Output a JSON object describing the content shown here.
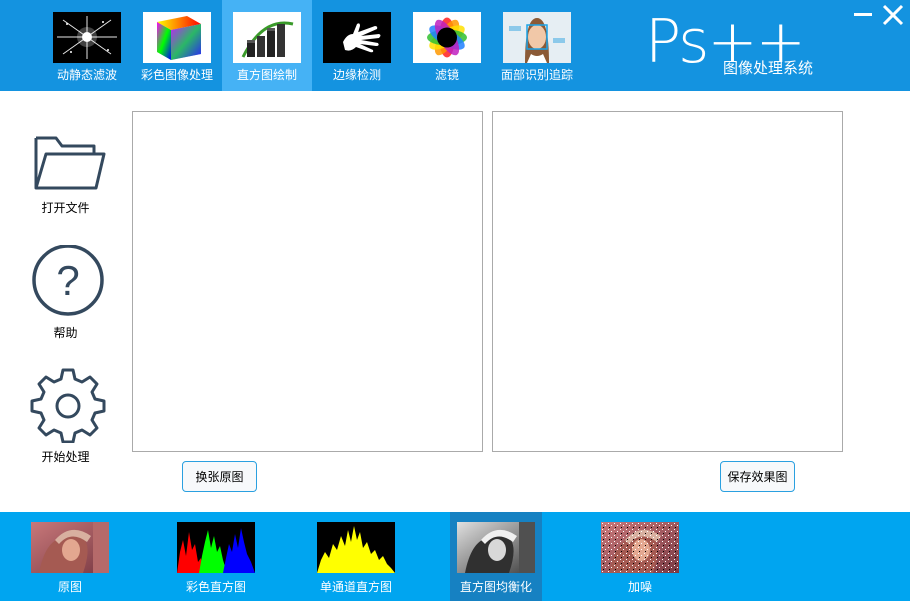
{
  "toolbar": {
    "items": [
      {
        "label": "动静态滤波",
        "icon": "starburst-filter-icon"
      },
      {
        "label": "彩色图像处理",
        "icon": "color-cube-icon"
      },
      {
        "label": "直方图绘制",
        "icon": "histogram-bars-icon"
      },
      {
        "label": "边缘检测",
        "icon": "hand-edge-icon"
      },
      {
        "label": "滤镜",
        "icon": "color-wheel-icon"
      },
      {
        "label": "面部识别追踪",
        "icon": "face-scan-icon"
      }
    ],
    "active_index": 2
  },
  "brand": {
    "logo": "Ps++",
    "subtitle": "图像处理系统"
  },
  "window": {
    "minimize_icon": "minimize-icon",
    "close_icon": "close-icon"
  },
  "sidebar": {
    "items": [
      {
        "label": "打开文件",
        "icon": "folder-icon"
      },
      {
        "label": "帮助",
        "icon": "help-icon"
      },
      {
        "label": "开始处理",
        "icon": "gear-icon"
      }
    ]
  },
  "main": {
    "change_image_label": "换张原图",
    "save_result_label": "保存效果图"
  },
  "bottombar": {
    "items": [
      {
        "label": "原图",
        "icon": "original-image-icon"
      },
      {
        "label": "彩色直方图",
        "icon": "color-histogram-icon"
      },
      {
        "label": "单通道直方图",
        "icon": "single-channel-histogram-icon"
      },
      {
        "label": "直方图均衡化",
        "icon": "histogram-equalization-icon"
      },
      {
        "label": "加噪",
        "icon": "add-noise-icon"
      }
    ],
    "active_index": 3
  },
  "colors": {
    "topbar": "#1493e0",
    "topbar_active": "#45b2f5",
    "bottombar": "#00a5f0",
    "bottombar_active": "#1681c2",
    "button_border": "#2aa0e0",
    "icon_stroke": "#34495e"
  }
}
